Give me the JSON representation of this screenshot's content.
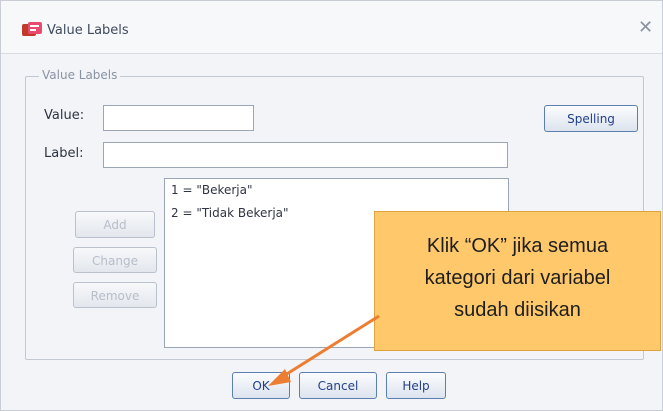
{
  "window": {
    "title": "Value Labels"
  },
  "group": {
    "title": "Value Labels"
  },
  "fields": {
    "value_label": "Value:",
    "value_text": "",
    "label_label": "Label:",
    "label_text": ""
  },
  "buttons": {
    "spelling": "Spelling",
    "add": "Add",
    "change": "Change",
    "remove": "Remove",
    "ok": "OK",
    "cancel": "Cancel",
    "help": "Help"
  },
  "list": {
    "items": [
      "1 = \"Bekerja\"",
      "2 = \"Tidak Bekerja\""
    ]
  },
  "callout": {
    "line1": "Klik “OK” jika semua",
    "line2": "kategori dari variabel",
    "line3": "sudah diisikan"
  },
  "colors": {
    "callout_bg": "#ffc86a",
    "arrow": "#ed7d31"
  }
}
